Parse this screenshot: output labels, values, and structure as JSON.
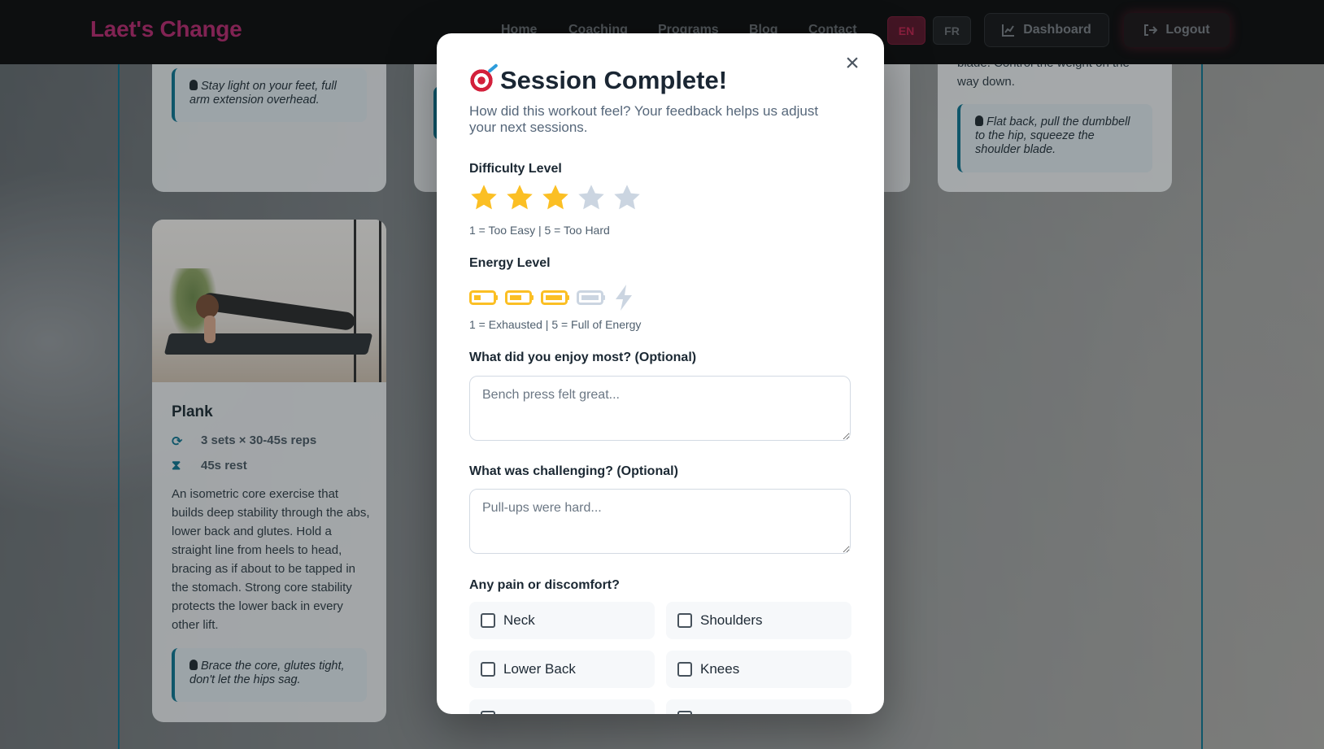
{
  "nav": {
    "brand": "Laet's Change",
    "links": [
      "Home",
      "Coaching",
      "Programs",
      "Blog",
      "Contact"
    ],
    "lang_en": "EN",
    "lang_fr": "FR",
    "dashboard_label": "Dashboard",
    "logout_label": "Logout"
  },
  "background": {
    "tip_top_left": "Stay light on your feet, full arm extension overhead.",
    "row_card_text": "blade. Control the weight on the way down.",
    "tip_top_right": "Flat back, pull the dumbbell to the hip, squeeze the shoulder blade.",
    "plank": {
      "title": "Plank",
      "sets": "3 sets × 30-45s reps",
      "rest": "45s rest",
      "description": "An isometric core exercise that builds deep stability through the abs, lower back and glutes. Hold a straight line from heels to head, bracing as if about to be tapped in the stomach. Strong core stability protects the lower back in every other lift.",
      "tip": "Brace the core, glutes tight, don't let the hips sag."
    }
  },
  "modal": {
    "title": "Session Complete!",
    "subtitle": "How did this workout feel? Your feedback helps us adjust your next sessions.",
    "difficulty_label": "Difficulty Level",
    "difficulty_rating": 3,
    "difficulty_max": 5,
    "difficulty_hint": "1 = Too Easy | 5 = Too Hard",
    "energy_label": "Energy Level",
    "energy_rating": 3,
    "energy_hint": "1 = Exhausted | 5 = Full of Energy",
    "enjoy_label": "What did you enjoy most? (Optional)",
    "enjoy_placeholder": "Bench press felt great...",
    "challenge_label": "What was challenging? (Optional)",
    "challenge_placeholder": "Pull-ups were hard...",
    "pain_label": "Any pain or discomfort?",
    "pain_options": [
      "Neck",
      "Shoulders",
      "Lower Back",
      "Knees"
    ]
  },
  "colors": {
    "accent": "#0e7490",
    "brand": "#b5296d",
    "star_active": "#fbbf24",
    "star_inactive": "#cbd5e1"
  }
}
